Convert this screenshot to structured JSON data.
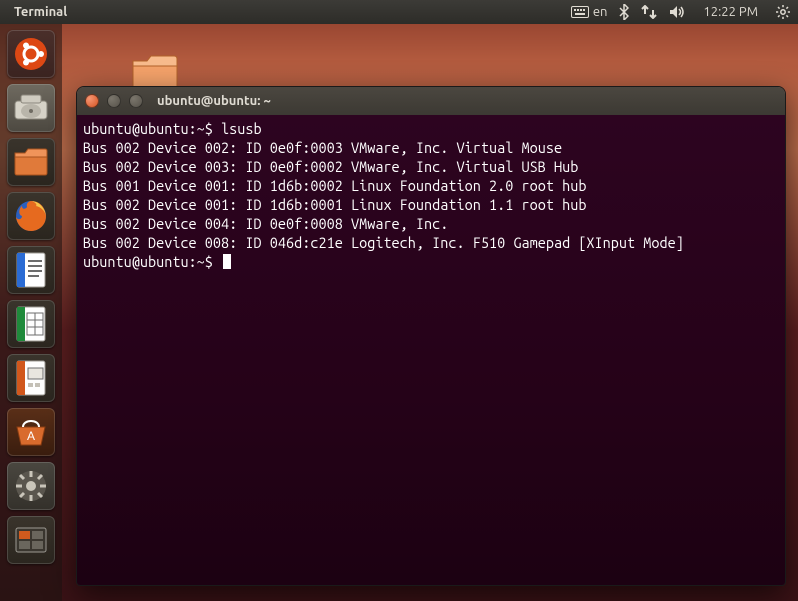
{
  "menubar": {
    "app_label": "Terminal",
    "keyboard_lang": "en",
    "clock": "12:22 PM"
  },
  "launcher": {
    "items": [
      {
        "name": "dash",
        "label": "Dash"
      },
      {
        "name": "home",
        "label": "Home Folder"
      },
      {
        "name": "files",
        "label": "Files"
      },
      {
        "name": "firefox",
        "label": "Firefox"
      },
      {
        "name": "writer",
        "label": "LibreOffice Writer"
      },
      {
        "name": "calc",
        "label": "LibreOffice Calc"
      },
      {
        "name": "impress",
        "label": "LibreOffice Impress"
      },
      {
        "name": "software",
        "label": "Ubuntu Software"
      },
      {
        "name": "settings",
        "label": "System Settings"
      },
      {
        "name": "recent",
        "label": "Workspace"
      }
    ]
  },
  "terminal": {
    "title": "ubuntu@ubuntu: ~",
    "prompt": "ubuntu@ubuntu:~$",
    "command": "lsusb",
    "output": [
      "Bus 002 Device 002: ID 0e0f:0003 VMware, Inc. Virtual Mouse",
      "Bus 002 Device 003: ID 0e0f:0002 VMware, Inc. Virtual USB Hub",
      "Bus 001 Device 001: ID 1d6b:0002 Linux Foundation 2.0 root hub",
      "Bus 002 Device 001: ID 1d6b:0001 Linux Foundation 1.1 root hub",
      "Bus 002 Device 004: ID 0e0f:0008 VMware, Inc.",
      "Bus 002 Device 008: ID 046d:c21e Logitech, Inc. F510 Gamepad [XInput Mode]"
    ]
  }
}
